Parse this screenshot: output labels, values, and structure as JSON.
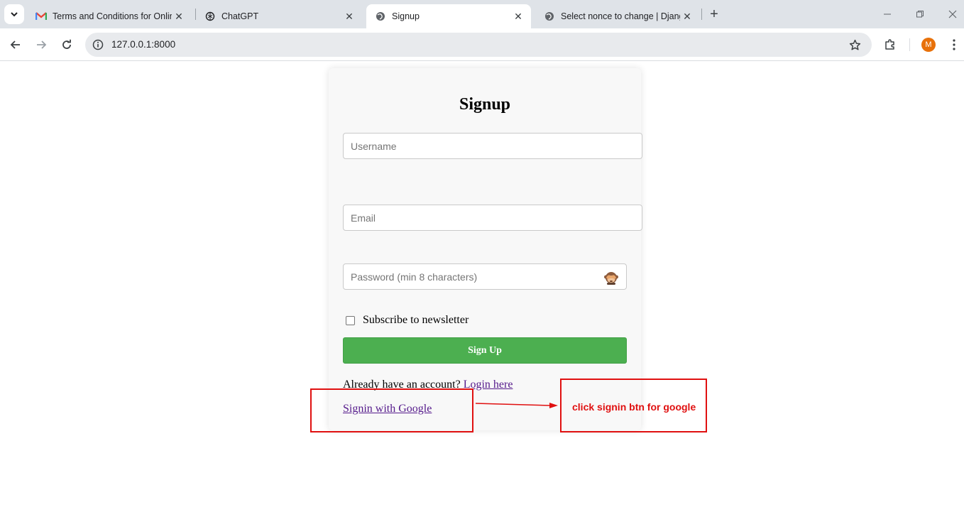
{
  "browser": {
    "tabs": [
      {
        "title": "Terms and Conditions for Onlin",
        "icon": "gmail-icon"
      },
      {
        "title": "ChatGPT",
        "icon": "chatgpt-icon"
      },
      {
        "title": "Signup",
        "icon": "globe-icon",
        "active": true
      },
      {
        "title": "Select nonce to change | Djang",
        "icon": "globe-icon"
      }
    ],
    "url": "127.0.0.1:8000",
    "avatar_letter": "M"
  },
  "form": {
    "title": "Signup",
    "username_placeholder": "Username",
    "email_placeholder": "Email",
    "password_placeholder": "Password (min 8 characters)",
    "newsletter_label": "Subscribe to newsletter",
    "submit_label": "Sign Up",
    "already_text": "Already have an account?",
    "login_link": "Login here",
    "google_link": "Signin with Google"
  },
  "annotation": {
    "text": "click signin btn for google",
    "color": "#e01010"
  }
}
